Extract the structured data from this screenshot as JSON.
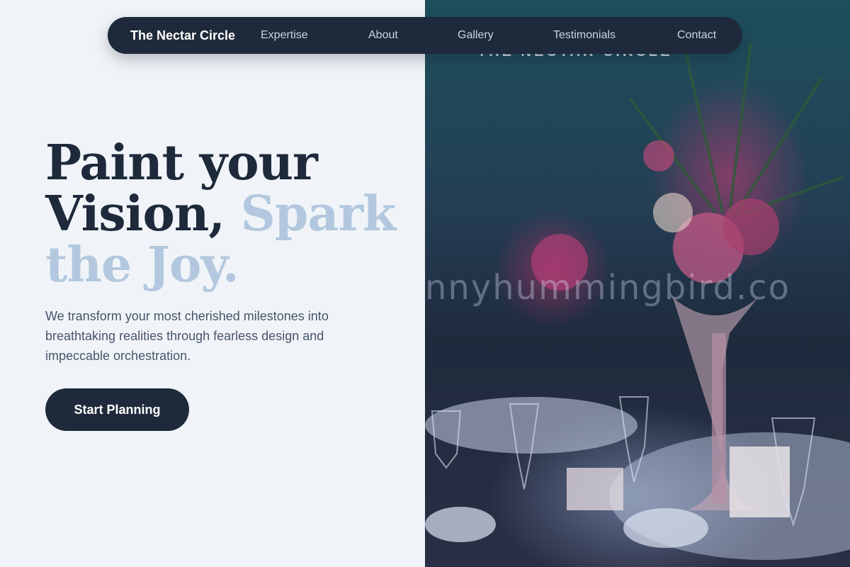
{
  "nav": {
    "brand": "The Nectar Circle",
    "links": [
      "Expertise",
      "About",
      "Gallery",
      "Testimonials",
      "Contact"
    ]
  },
  "hero": {
    "headline_line1": "Paint your",
    "headline_line2_dark": "Vision,",
    "headline_line2_accent": "Spark",
    "headline_line3_accent": "the Joy.",
    "subtext": "We transform your most cherished milestones into breathtaking realities through fearless design and impeccable orchestration.",
    "cta_label": "Start Planning"
  },
  "image": {
    "overlay_text": "THE NECTAR CIRCLE",
    "watermark_text": "nnyhummingbird.co"
  },
  "colors": {
    "primary": "#1e293b",
    "accent": "#b3c8de",
    "background": "#f0f4f8",
    "body_text": "#475569"
  }
}
